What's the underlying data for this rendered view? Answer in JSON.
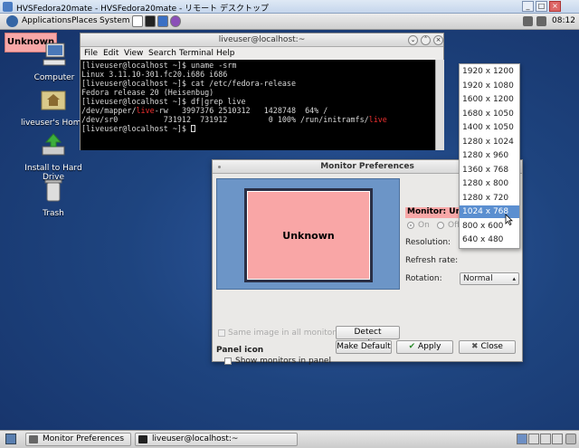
{
  "host_window": {
    "title": "HVSFedora20mate - HVSFedora20mate - リモート デスクトップ"
  },
  "top_panel": {
    "menus": [
      "Applications",
      "Places",
      "System"
    ],
    "clock": "08:12"
  },
  "desktop": {
    "unknown_tag": "Unknown",
    "icons": [
      {
        "label": "Computer",
        "icon": "computer-icon"
      },
      {
        "label": "liveuser's Home",
        "icon": "home-folder-icon"
      },
      {
        "label": "Install to Hard Drive",
        "icon": "install-icon"
      },
      {
        "label": "Trash",
        "icon": "trash-icon"
      }
    ]
  },
  "terminal": {
    "title": "liveuser@localhost:~",
    "menu": [
      "File",
      "Edit",
      "View",
      "Search",
      "Terminal",
      "Help"
    ],
    "lines": [
      "[liveuser@localhost ~]$ uname -srm",
      "Linux 3.11.10-301.fc20.i686 i686",
      "[liveuser@localhost ~]$ cat /etc/fedora-release",
      "Fedora release 20 (Heisenbug)",
      "[liveuser@localhost ~]$ df|grep live"
    ],
    "df_row1": {
      "a": "/dev/mapper/",
      "b": "live",
      "c": "-rw   3997376 2510312   1428748  64% /"
    },
    "df_row2": {
      "a": "/dev/sr0          731912  731912         0 100% /run/initramfs/",
      "b": "live"
    },
    "prompt": "[liveuser@localhost ~]$ "
  },
  "dialog": {
    "title": "Monitor Preferences",
    "monitor_box_label": "Unknown",
    "monitor_label": "Monitor: Unknown",
    "on_label": "On",
    "off_label": "Off",
    "resolution_label": "Resolution:",
    "refresh_label": "Refresh rate:",
    "rotation_label": "Rotation:",
    "rotation_value": "Normal",
    "same_image_label": "Same image in all monitors",
    "detect_button": "Detect monitors",
    "panel_icon_heading": "Panel icon",
    "show_monitors_label": "Show monitors in panel",
    "make_default_button": "Make Default",
    "apply_button": "Apply",
    "close_button": "Close"
  },
  "resolutions": {
    "items": [
      "1920 x 1200",
      "1920 x 1080",
      "1600 x 1200",
      "1680 x 1050",
      "1400 x 1050",
      "1280 x 1024",
      "1280 x 960",
      "1360 x 768",
      "1280 x 800",
      "1280 x 720",
      "1024 x 768",
      "800 x 600",
      "640 x 480"
    ],
    "selected": "1024 x 768"
  },
  "bottom_panel": {
    "tasks": [
      "Monitor Preferences",
      "liveuser@localhost:~"
    ]
  }
}
